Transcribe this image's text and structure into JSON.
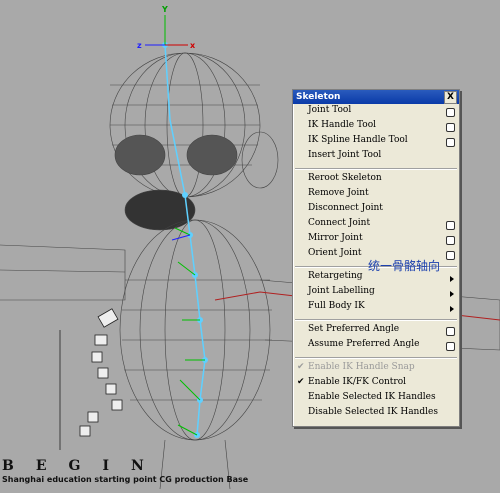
{
  "menu": {
    "title": "Skeleton",
    "close_label": "X",
    "groups": [
      [
        {
          "label": "Joint Tool",
          "option": true
        },
        {
          "label": "IK Handle Tool",
          "option": true
        },
        {
          "label": "IK Spline Handle Tool",
          "option": true
        },
        {
          "label": "Insert Joint Tool",
          "option": false
        }
      ],
      [
        {
          "label": "Reroot Skeleton"
        },
        {
          "label": "Remove Joint"
        },
        {
          "label": "Disconnect Joint"
        },
        {
          "label": "Connect Joint",
          "option": true
        },
        {
          "label": "Mirror Joint",
          "option": true
        },
        {
          "label": "Orient Joint",
          "option": true
        }
      ],
      [
        {
          "label": "Retargeting",
          "submenu": true
        },
        {
          "label": "Joint Labelling",
          "submenu": true
        },
        {
          "label": "Full Body IK",
          "submenu": true
        }
      ],
      [
        {
          "label": "Set Preferred Angle",
          "option": true
        },
        {
          "label": "Assume Preferred Angle",
          "option": true
        }
      ],
      [
        {
          "label": "Enable IK Handle Snap",
          "checked": true,
          "disabled": true
        },
        {
          "label": "Enable IK/FK Control",
          "checked": true
        },
        {
          "label": "Enable Selected IK Handles"
        },
        {
          "label": "Disable Selected IK Handles"
        }
      ]
    ]
  },
  "annotation": "统一骨骼轴向",
  "watermark": {
    "title": "BEGIN",
    "subtitle": "Shanghai education starting point CG production Base"
  },
  "axis_labels": {
    "x": "x",
    "y": "Y",
    "z": "z"
  },
  "colors": {
    "title_bar": "#0a3aa8",
    "menu_bg": "#ece9d8",
    "viewport_bg": "#a9a9a9",
    "annotation": "#1a3fae"
  }
}
